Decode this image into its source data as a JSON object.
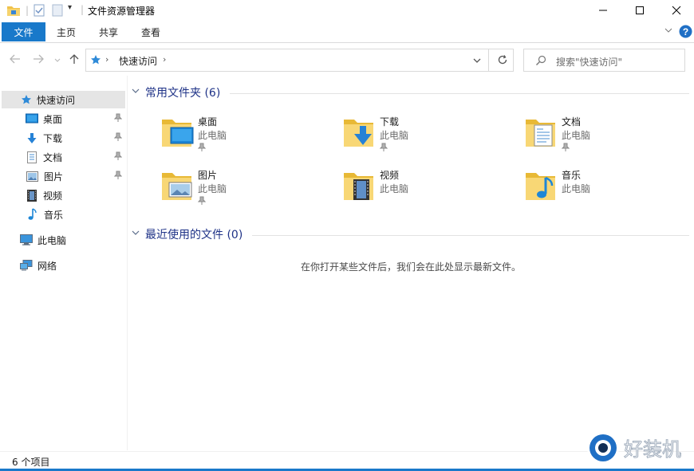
{
  "window": {
    "title": "文件资源管理器",
    "accent": "#1979ca"
  },
  "ribbon": {
    "tabs": [
      {
        "label": "文件"
      },
      {
        "label": "主页"
      },
      {
        "label": "共享"
      },
      {
        "label": "查看"
      }
    ]
  },
  "address": {
    "crumb": "快速访问"
  },
  "search": {
    "placeholder": "搜索\"快速访问\""
  },
  "nav": {
    "quick_access": "快速访问",
    "items": [
      {
        "label": "桌面",
        "icon": "desktop-icon",
        "pinned": true
      },
      {
        "label": "下载",
        "icon": "download-icon",
        "pinned": true
      },
      {
        "label": "文档",
        "icon": "document-icon",
        "pinned": true
      },
      {
        "label": "图片",
        "icon": "picture-icon",
        "pinned": true
      },
      {
        "label": "视频",
        "icon": "video-icon",
        "pinned": false
      },
      {
        "label": "音乐",
        "icon": "music-icon",
        "pinned": false
      }
    ],
    "this_pc": "此电脑",
    "network": "网络"
  },
  "frequent": {
    "heading": "常用文件夹 (6)",
    "folders": [
      {
        "name": "桌面",
        "location": "此电脑"
      },
      {
        "name": "下载",
        "location": "此电脑"
      },
      {
        "name": "文档",
        "location": "此电脑"
      },
      {
        "name": "图片",
        "location": "此电脑"
      },
      {
        "name": "视频",
        "location": "此电脑"
      },
      {
        "name": "音乐",
        "location": "此电脑"
      }
    ]
  },
  "recent": {
    "heading": "最近使用的文件 (0)",
    "empty_message": "在你打开某些文件后，我们会在此处显示最新文件。"
  },
  "status": {
    "count": "6 个项目"
  },
  "watermark": {
    "text": "好装机"
  }
}
